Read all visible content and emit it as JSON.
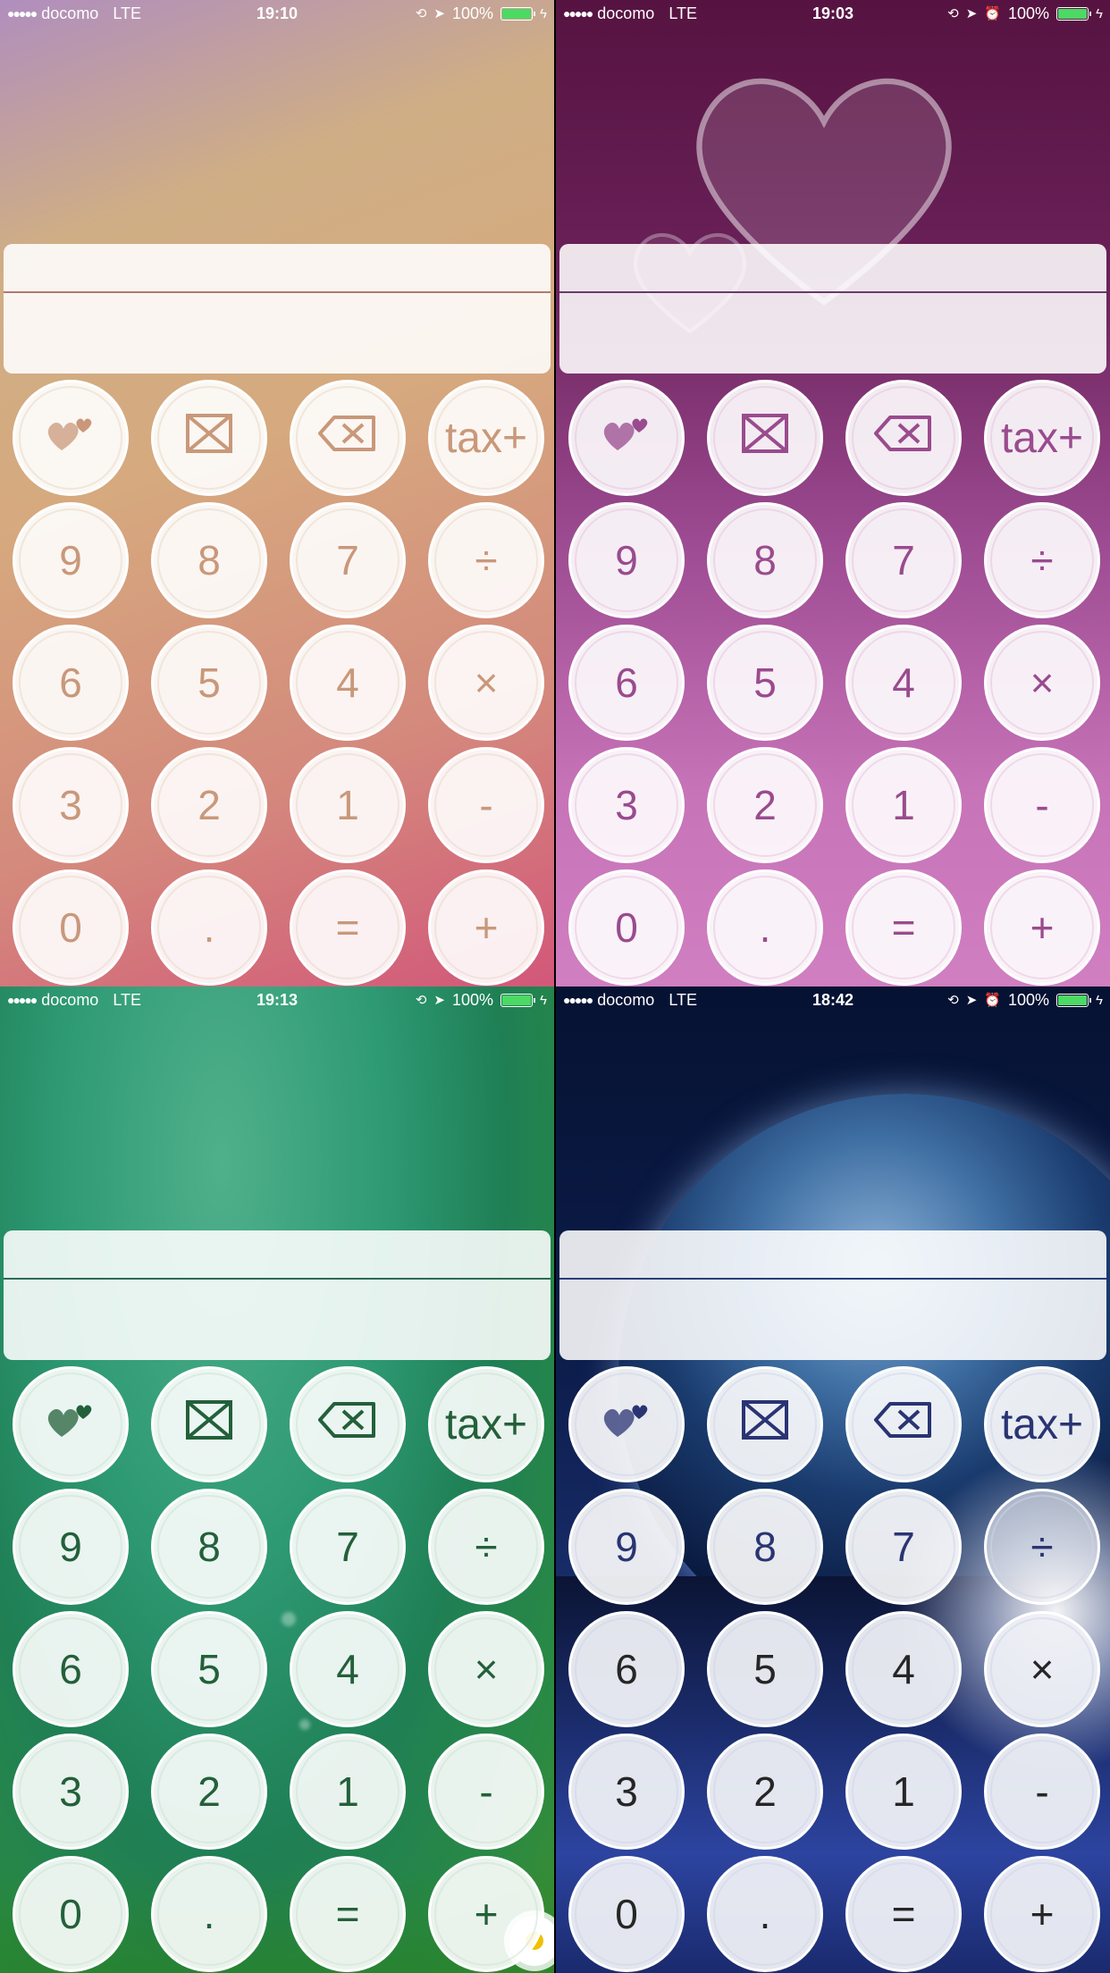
{
  "panels": [
    {
      "carrier": "docomo",
      "network": "LTE",
      "time": "19:10",
      "battery": "100%",
      "alarm_icon": false
    },
    {
      "carrier": "docomo",
      "network": "LTE",
      "time": "19:03",
      "battery": "100%",
      "alarm_icon": true
    },
    {
      "carrier": "docomo",
      "network": "LTE",
      "time": "19:13",
      "battery": "100%",
      "alarm_icon": false
    },
    {
      "carrier": "docomo",
      "network": "LTE",
      "time": "18:42",
      "battery": "100%",
      "alarm_icon": true
    }
  ],
  "status_icons": [
    "rotation-lock-icon",
    "location-arrow-icon",
    "alarm-clock-icon",
    "battery-icon",
    "charging-bolt-icon"
  ],
  "keypad": {
    "row1": [
      "hearts-theme-icon",
      "clear-all-icon",
      "backspace-icon",
      "tax+"
    ],
    "row2": [
      "9",
      "8",
      "7",
      "÷"
    ],
    "row3": [
      "6",
      "5",
      "4",
      "×"
    ],
    "row4": [
      "3",
      "2",
      "1",
      "-"
    ],
    "row5": [
      "0",
      ".",
      "=",
      "+"
    ]
  },
  "display": {
    "upper": "",
    "lower": ""
  },
  "colors": {
    "battery_green": "#4cd964",
    "theme_peach": "#c9987a",
    "theme_pink": "#9a4b8e",
    "theme_green": "#23603a",
    "theme_navy": "#2a3473"
  }
}
